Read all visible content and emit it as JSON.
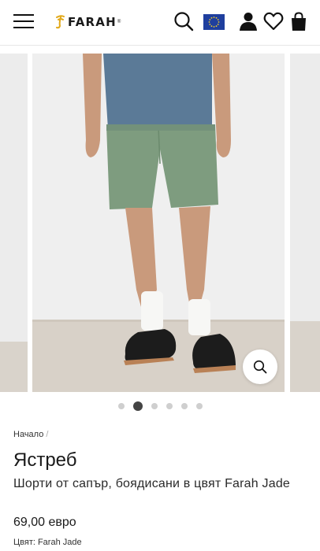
{
  "header": {
    "menu_icon": "hamburger-menu-icon",
    "logo_text": "FARAH",
    "logo_reg": "®",
    "icons": [
      "search-icon",
      "eu-flag-icon",
      "user-icon",
      "heart-icon",
      "shopping-bag-icon"
    ]
  },
  "gallery": {
    "slide_count": 6,
    "active_slide": 2,
    "zoom_icon": "zoom-icon"
  },
  "product": {
    "breadcrumb": "Начало",
    "breadcrumb_sep": "/",
    "title": "Ястреб",
    "subtitle": "Шорти от сапър, боядисани в цвят Farah Jade",
    "price": "69,00 евро",
    "color_line": "Цвят: Farah Jade"
  },
  "colors": {
    "shorts": "#7e9c7f",
    "tshirt": "#5b7a97",
    "eu_blue": "#1f3f9e",
    "eu_star": "#f5cf2b",
    "logo_mark": "#e2a91a"
  }
}
